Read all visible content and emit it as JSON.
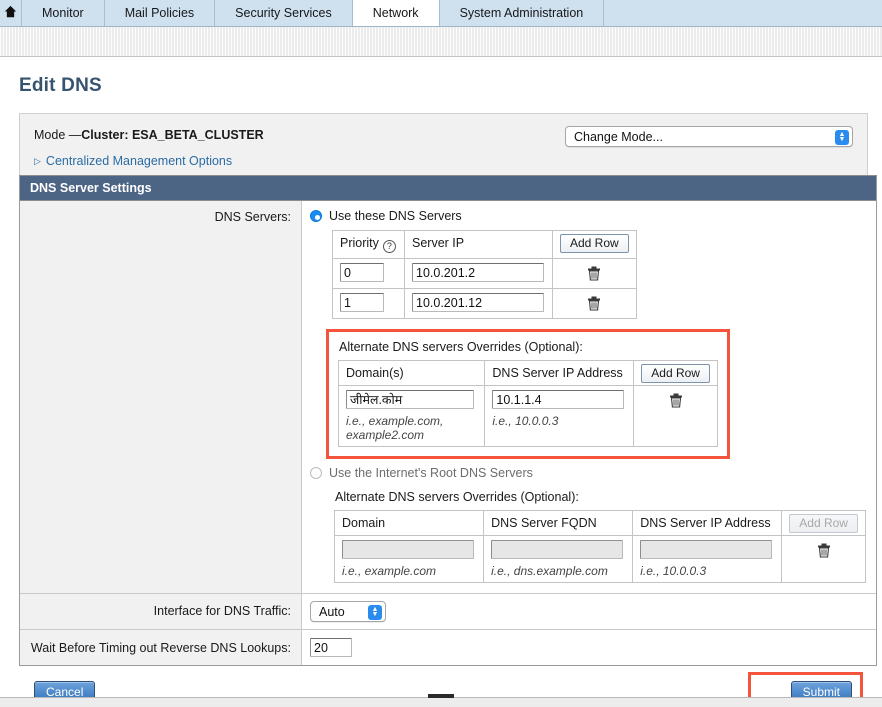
{
  "nav": {
    "home_icon": "home-icon",
    "tabs": [
      {
        "label": "Monitor",
        "selected": false
      },
      {
        "label": "Mail Policies",
        "selected": false
      },
      {
        "label": "Security Services",
        "selected": false
      },
      {
        "label": "Network",
        "selected": true
      },
      {
        "label": "System Administration",
        "selected": false
      }
    ]
  },
  "page": {
    "title": "Edit DNS"
  },
  "mode": {
    "prefix": "Mode —",
    "cluster_label": "Cluster: ESA_BETA_CLUSTER",
    "centralized_management_options": "Centralized Management Options",
    "expand_icon": "triangle-right-icon",
    "change_mode_select": "Change Mode...",
    "change_mode_icon": "stepper-up-down-icon"
  },
  "section": {
    "title": "DNS Server Settings"
  },
  "dns_servers": {
    "row_label": "DNS Servers:",
    "option_use_these": "Use these DNS Servers",
    "option_use_these_selected": true,
    "option_use_root": "Use the Internet's Root DNS Servers",
    "option_use_root_selected": false,
    "servers_table": {
      "headers": [
        "Priority",
        "Server IP",
        "Add Row"
      ],
      "help_icon": "help-question-icon",
      "add_row_label": "Add Row",
      "delete_icon": "trash-icon",
      "rows": [
        {
          "priority": "0",
          "server_ip": "10.0.201.2"
        },
        {
          "priority": "1",
          "server_ip": "10.0.201.12"
        }
      ]
    },
    "alt_overrides_primary": {
      "title": "Alternate DNS servers Overrides (Optional):",
      "highlighted": true,
      "headers": [
        "Domain(s)",
        "DNS Server IP Address",
        "Add Row"
      ],
      "add_row_label": "Add Row",
      "delete_icon": "trash-icon",
      "rows": [
        {
          "domain": "जीमेल.कोम",
          "dns_ip": "10.1.1.4"
        }
      ],
      "hints": [
        "i.e., example.com, example2.com",
        "i.e., 10.0.0.3"
      ]
    },
    "alt_overrides_root": {
      "title": "Alternate DNS servers Overrides (Optional):",
      "headers": [
        "Domain",
        "DNS Server FQDN",
        "DNS Server IP Address",
        "Add Row"
      ],
      "add_row_label": "Add Row",
      "add_row_disabled": true,
      "delete_icon": "trash-icon",
      "rows": [
        {
          "domain": "",
          "fqdn": "",
          "dns_ip": ""
        }
      ],
      "hints": [
        "i.e., example.com",
        "i.e., dns.example.com",
        "i.e., 10.0.0.3"
      ]
    }
  },
  "interface_row": {
    "label": "Interface for DNS Traffic:",
    "value": "Auto",
    "select_icon": "stepper-up-down-icon"
  },
  "timeout_row": {
    "label": "Wait Before Timing out Reverse DNS Lookups:",
    "value": "20"
  },
  "footer": {
    "cancel_label": "Cancel",
    "submit_label": "Submit",
    "submit_highlighted": true
  },
  "colors": {
    "tab_bar": "#cfe0ef",
    "section_header": "#4d6585",
    "title": "#37546f",
    "link": "#2b6ca3",
    "highlight": "#f4543c",
    "radio_on": "#1a8cf5",
    "button_blue": "#2f6fb8"
  }
}
